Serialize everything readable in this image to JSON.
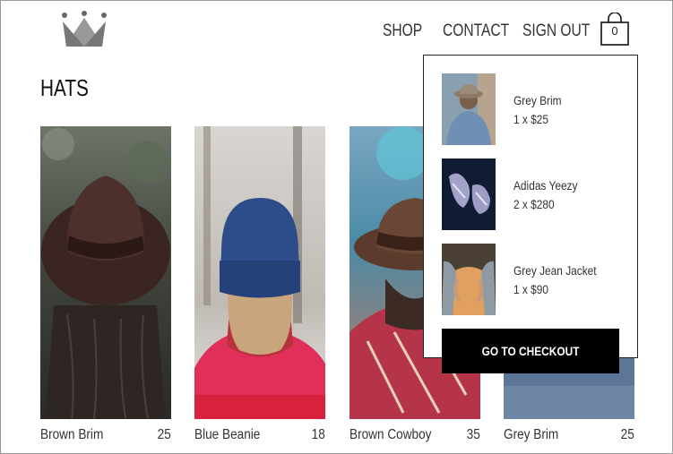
{
  "nav": {
    "shop": "SHOP",
    "contact": "CONTACT",
    "sign_out": "SIGN OUT",
    "cart_count": "0"
  },
  "page": {
    "title": "HATS"
  },
  "products": [
    {
      "name": "Brown Brim",
      "price": "25"
    },
    {
      "name": "Blue Beanie",
      "price": "18"
    },
    {
      "name": "Brown Cowboy",
      "price": "35"
    },
    {
      "name": "Grey Brim",
      "price": "25"
    }
  ],
  "cart": {
    "items": [
      {
        "name": "Grey Brim",
        "quantity_price": "1 x $25"
      },
      {
        "name": "Adidas Yeezy",
        "quantity_price": "2 x $280"
      },
      {
        "name": "Grey Jean Jacket",
        "quantity_price": "1 x $90"
      }
    ],
    "checkout_label": "GO TO CHECKOUT"
  },
  "icons": {
    "logo": "crown-icon",
    "cart": "shopping-bag-icon"
  },
  "colors": {
    "accent": "#000000",
    "text": "#333333",
    "border": "#222222"
  }
}
